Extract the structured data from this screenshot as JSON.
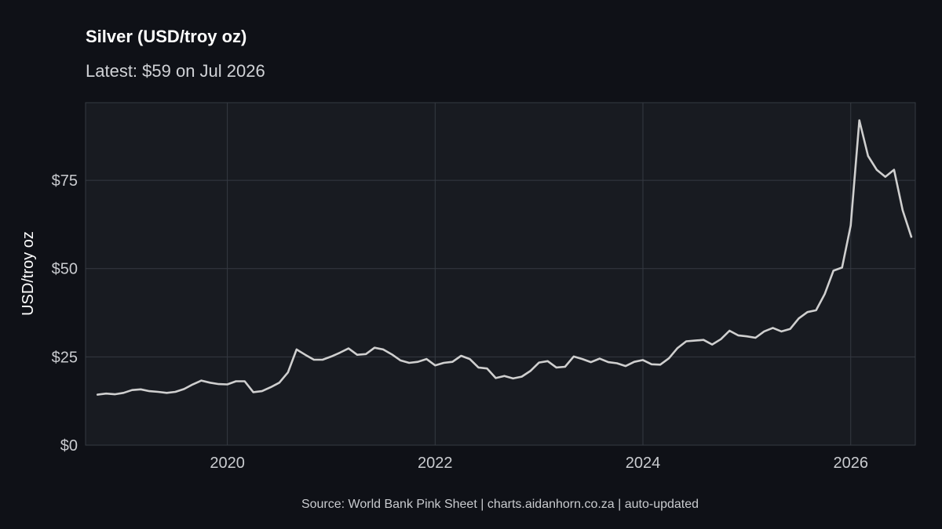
{
  "chart_data": {
    "type": "line",
    "title": "Silver (USD/troy oz)",
    "subtitle": "Latest: $59 on Jul 2026",
    "xlabel": "",
    "ylabel": "USD/troy oz",
    "caption": "Source: World Bank Pink Sheet | charts.aidanhorn.co.za | auto-updated",
    "x_start": "2018-10",
    "frequency": "monthly",
    "xlim": [
      "2018-08-20",
      "2026-08-15"
    ],
    "ylim": [
      0,
      97
    ],
    "x_ticks": [
      {
        "x": 2020,
        "label": "2020"
      },
      {
        "x": 2022,
        "label": "2022"
      },
      {
        "x": 2024,
        "label": "2024"
      },
      {
        "x": 2026,
        "label": "2026"
      }
    ],
    "y_ticks": [
      {
        "y": 0,
        "label": "$0"
      },
      {
        "y": 25,
        "label": "$25"
      },
      {
        "y": 50,
        "label": "$50"
      },
      {
        "y": 75,
        "label": "$75"
      }
    ],
    "grid": true,
    "colors": {
      "background": "#0f1117",
      "panel": "#181b21",
      "grid": "#353a42",
      "line": "#cfcfcf"
    },
    "values": [
      14.3,
      14.6,
      14.4,
      14.8,
      15.6,
      15.8,
      15.3,
      15.1,
      14.8,
      15.1,
      15.9,
      17.2,
      18.3,
      17.7,
      17.3,
      17.2,
      18.1,
      18.1,
      15.0,
      15.3,
      16.4,
      17.7,
      20.6,
      27.1,
      25.6,
      24.2,
      24.2,
      25.1,
      26.2,
      27.4,
      25.6,
      25.8,
      27.6,
      27.1,
      25.7,
      24.0,
      23.3,
      23.6,
      24.4,
      22.6,
      23.3,
      23.6,
      25.3,
      24.4,
      22.0,
      21.7,
      19.0,
      19.6,
      18.9,
      19.4,
      21.0,
      23.4,
      23.8,
      22.0,
      22.2,
      25.1,
      24.4,
      23.5,
      24.5,
      23.5,
      23.2,
      22.4,
      23.6,
      24.1,
      22.9,
      22.8,
      24.6,
      27.5,
      29.4,
      29.6,
      29.8,
      28.5,
      30.0,
      32.4,
      31.1,
      30.8,
      30.4,
      32.2,
      33.2,
      32.2,
      32.9,
      35.9,
      37.7,
      38.2,
      42.8,
      49.4,
      50.3,
      62.2,
      92.0,
      81.9,
      78.0,
      76.0,
      78.0,
      66.5,
      59.0
    ]
  }
}
